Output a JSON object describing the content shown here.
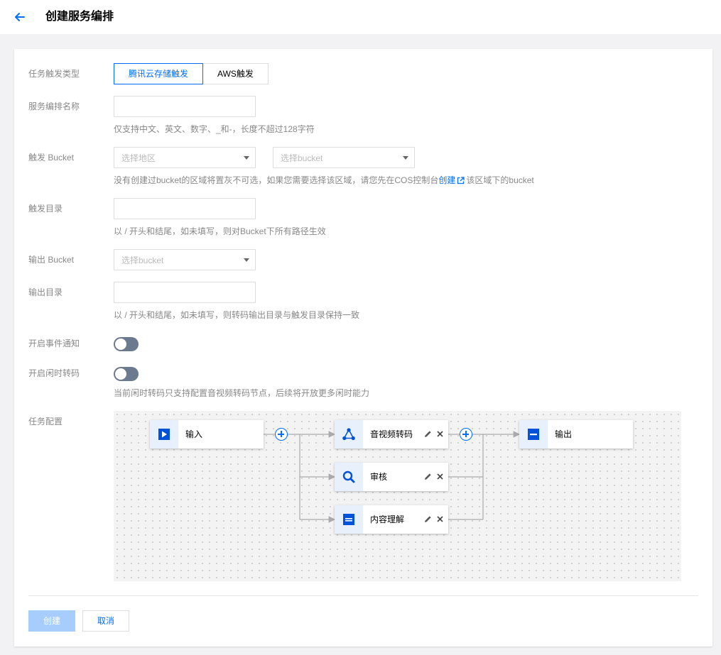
{
  "header": {
    "title": "创建服务编排"
  },
  "form": {
    "trigger_type": {
      "label": "任务触发类型",
      "options": [
        "腾讯云存储触发",
        "AWS触发"
      ],
      "selected": "腾讯云存储触发"
    },
    "name": {
      "label": "服务编排名称",
      "value": "",
      "hint": "仅支持中文、英文、数字、_和-，长度不超过128字符"
    },
    "trigger_bucket": {
      "label": "触发 Bucket",
      "region_placeholder": "选择地区",
      "bucket_placeholder": "选择bucket",
      "hint_before": "没有创建过bucket的区域将置灰不可选，如果您需要选择该区域，请您先在COS控制台",
      "hint_link": "创建",
      "hint_after": "该区域下的bucket"
    },
    "trigger_dir": {
      "label": "触发目录",
      "value": "",
      "hint": "以 / 开头和结尾，如未填写，则对Bucket下所有路径生效"
    },
    "output_bucket": {
      "label": "输出 Bucket",
      "placeholder": "选择bucket"
    },
    "output_dir": {
      "label": "输出目录",
      "value": "",
      "hint": "以 / 开头和结尾，如未填写，则转码输出目录与触发目录保持一致"
    },
    "event_notify": {
      "label": "开启事件通知",
      "enabled": false
    },
    "idle_transcode": {
      "label": "开启闲时转码",
      "enabled": false,
      "hint": "当前闲时转码只支持配置音视频转码节点，后续将开放更多闲时能力"
    },
    "task_config": {
      "label": "任务配置",
      "nodes": [
        {
          "id": "input",
          "label": "输入",
          "icon": "play-icon"
        },
        {
          "id": "transcode",
          "label": "音视频转码",
          "icon": "transcode-icon"
        },
        {
          "id": "audit",
          "label": "审核",
          "icon": "search-icon"
        },
        {
          "id": "content",
          "label": "内容理解",
          "icon": "content-icon"
        },
        {
          "id": "output",
          "label": "输出",
          "icon": "output-icon"
        }
      ]
    }
  },
  "footer": {
    "create_label": "创建",
    "cancel_label": "取消"
  },
  "colors": {
    "accent": "#006eff",
    "disabled_primary": "#a6cdfc",
    "toggle_off": "#6c7a8f"
  }
}
